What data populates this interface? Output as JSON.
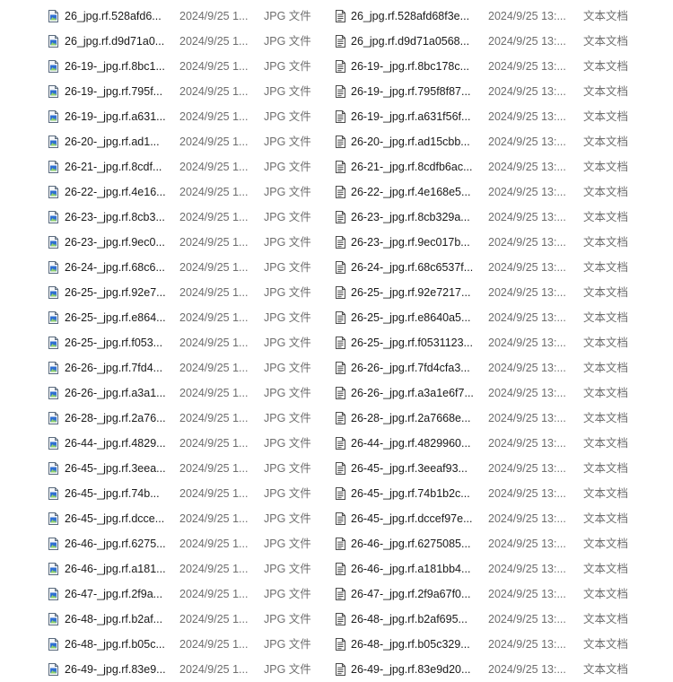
{
  "left_list": {
    "icon": "jpg-file-icon",
    "rows": [
      {
        "name": "26_jpg.rf.528afd6...",
        "date": "2024/9/25 1...",
        "type": "JPG 文件"
      },
      {
        "name": "26_jpg.rf.d9d71a0...",
        "date": "2024/9/25 1...",
        "type": "JPG 文件"
      },
      {
        "name": "26-19-_jpg.rf.8bc1...",
        "date": "2024/9/25 1...",
        "type": "JPG 文件"
      },
      {
        "name": "26-19-_jpg.rf.795f...",
        "date": "2024/9/25 1...",
        "type": "JPG 文件"
      },
      {
        "name": "26-19-_jpg.rf.a631...",
        "date": "2024/9/25 1...",
        "type": "JPG 文件"
      },
      {
        "name": "26-20-_jpg.rf.ad1...",
        "date": "2024/9/25 1...",
        "type": "JPG 文件"
      },
      {
        "name": "26-21-_jpg.rf.8cdf...",
        "date": "2024/9/25 1...",
        "type": "JPG 文件"
      },
      {
        "name": "26-22-_jpg.rf.4e16...",
        "date": "2024/9/25 1...",
        "type": "JPG 文件"
      },
      {
        "name": "26-23-_jpg.rf.8cb3...",
        "date": "2024/9/25 1...",
        "type": "JPG 文件"
      },
      {
        "name": "26-23-_jpg.rf.9ec0...",
        "date": "2024/9/25 1...",
        "type": "JPG 文件"
      },
      {
        "name": "26-24-_jpg.rf.68c6...",
        "date": "2024/9/25 1...",
        "type": "JPG 文件"
      },
      {
        "name": "26-25-_jpg.rf.92e7...",
        "date": "2024/9/25 1...",
        "type": "JPG 文件"
      },
      {
        "name": "26-25-_jpg.rf.e864...",
        "date": "2024/9/25 1...",
        "type": "JPG 文件"
      },
      {
        "name": "26-25-_jpg.rf.f053...",
        "date": "2024/9/25 1...",
        "type": "JPG 文件"
      },
      {
        "name": "26-26-_jpg.rf.7fd4...",
        "date": "2024/9/25 1...",
        "type": "JPG 文件"
      },
      {
        "name": "26-26-_jpg.rf.a3a1...",
        "date": "2024/9/25 1...",
        "type": "JPG 文件"
      },
      {
        "name": "26-28-_jpg.rf.2a76...",
        "date": "2024/9/25 1...",
        "type": "JPG 文件"
      },
      {
        "name": "26-44-_jpg.rf.4829...",
        "date": "2024/9/25 1...",
        "type": "JPG 文件"
      },
      {
        "name": "26-45-_jpg.rf.3eea...",
        "date": "2024/9/25 1...",
        "type": "JPG 文件"
      },
      {
        "name": "26-45-_jpg.rf.74b...",
        "date": "2024/9/25 1...",
        "type": "JPG 文件"
      },
      {
        "name": "26-45-_jpg.rf.dcce...",
        "date": "2024/9/25 1...",
        "type": "JPG 文件"
      },
      {
        "name": "26-46-_jpg.rf.6275...",
        "date": "2024/9/25 1...",
        "type": "JPG 文件"
      },
      {
        "name": "26-46-_jpg.rf.a181...",
        "date": "2024/9/25 1...",
        "type": "JPG 文件"
      },
      {
        "name": "26-47-_jpg.rf.2f9a...",
        "date": "2024/9/25 1...",
        "type": "JPG 文件"
      },
      {
        "name": "26-48-_jpg.rf.b2af...",
        "date": "2024/9/25 1...",
        "type": "JPG 文件"
      },
      {
        "name": "26-48-_jpg.rf.b05c...",
        "date": "2024/9/25 1...",
        "type": "JPG 文件"
      },
      {
        "name": "26-49-_jpg.rf.83e9...",
        "date": "2024/9/25 1...",
        "type": "JPG 文件"
      }
    ]
  },
  "right_list": {
    "icon": "text-document-icon",
    "rows": [
      {
        "name": "26_jpg.rf.528afd68f3e...",
        "date": "2024/9/25 13:...",
        "type": "文本文档"
      },
      {
        "name": "26_jpg.rf.d9d71a0568...",
        "date": "2024/9/25 13:...",
        "type": "文本文档"
      },
      {
        "name": "26-19-_jpg.rf.8bc178c...",
        "date": "2024/9/25 13:...",
        "type": "文本文档"
      },
      {
        "name": "26-19-_jpg.rf.795f8f87...",
        "date": "2024/9/25 13:...",
        "type": "文本文档"
      },
      {
        "name": "26-19-_jpg.rf.a631f56f...",
        "date": "2024/9/25 13:...",
        "type": "文本文档"
      },
      {
        "name": "26-20-_jpg.rf.ad15cbb...",
        "date": "2024/9/25 13:...",
        "type": "文本文档"
      },
      {
        "name": "26-21-_jpg.rf.8cdfb6ac...",
        "date": "2024/9/25 13:...",
        "type": "文本文档"
      },
      {
        "name": "26-22-_jpg.rf.4e168e5...",
        "date": "2024/9/25 13:...",
        "type": "文本文档"
      },
      {
        "name": "26-23-_jpg.rf.8cb329a...",
        "date": "2024/9/25 13:...",
        "type": "文本文档"
      },
      {
        "name": "26-23-_jpg.rf.9ec017b...",
        "date": "2024/9/25 13:...",
        "type": "文本文档"
      },
      {
        "name": "26-24-_jpg.rf.68c6537f...",
        "date": "2024/9/25 13:...",
        "type": "文本文档"
      },
      {
        "name": "26-25-_jpg.rf.92e7217...",
        "date": "2024/9/25 13:...",
        "type": "文本文档"
      },
      {
        "name": "26-25-_jpg.rf.e8640a5...",
        "date": "2024/9/25 13:...",
        "type": "文本文档"
      },
      {
        "name": "26-25-_jpg.rf.f0531123...",
        "date": "2024/9/25 13:...",
        "type": "文本文档"
      },
      {
        "name": "26-26-_jpg.rf.7fd4cfa3...",
        "date": "2024/9/25 13:...",
        "type": "文本文档"
      },
      {
        "name": "26-26-_jpg.rf.a3a1e6f7...",
        "date": "2024/9/25 13:...",
        "type": "文本文档"
      },
      {
        "name": "26-28-_jpg.rf.2a7668e...",
        "date": "2024/9/25 13:...",
        "type": "文本文档"
      },
      {
        "name": "26-44-_jpg.rf.4829960...",
        "date": "2024/9/25 13:...",
        "type": "文本文档"
      },
      {
        "name": "26-45-_jpg.rf.3eeaf93...",
        "date": "2024/9/25 13:...",
        "type": "文本文档"
      },
      {
        "name": "26-45-_jpg.rf.74b1b2c...",
        "date": "2024/9/25 13:...",
        "type": "文本文档"
      },
      {
        "name": "26-45-_jpg.rf.dccef97e...",
        "date": "2024/9/25 13:...",
        "type": "文本文档"
      },
      {
        "name": "26-46-_jpg.rf.6275085...",
        "date": "2024/9/25 13:...",
        "type": "文本文档"
      },
      {
        "name": "26-46-_jpg.rf.a181bb4...",
        "date": "2024/9/25 13:...",
        "type": "文本文档"
      },
      {
        "name": "26-47-_jpg.rf.2f9a67f0...",
        "date": "2024/9/25 13:...",
        "type": "文本文档"
      },
      {
        "name": "26-48-_jpg.rf.b2af695...",
        "date": "2024/9/25 13:...",
        "type": "文本文档"
      },
      {
        "name": "26-48-_jpg.rf.b05c329...",
        "date": "2024/9/25 13:...",
        "type": "文本文档"
      },
      {
        "name": "26-49-_jpg.rf.83e9d20...",
        "date": "2024/9/25 13:...",
        "type": "文本文档"
      }
    ]
  }
}
